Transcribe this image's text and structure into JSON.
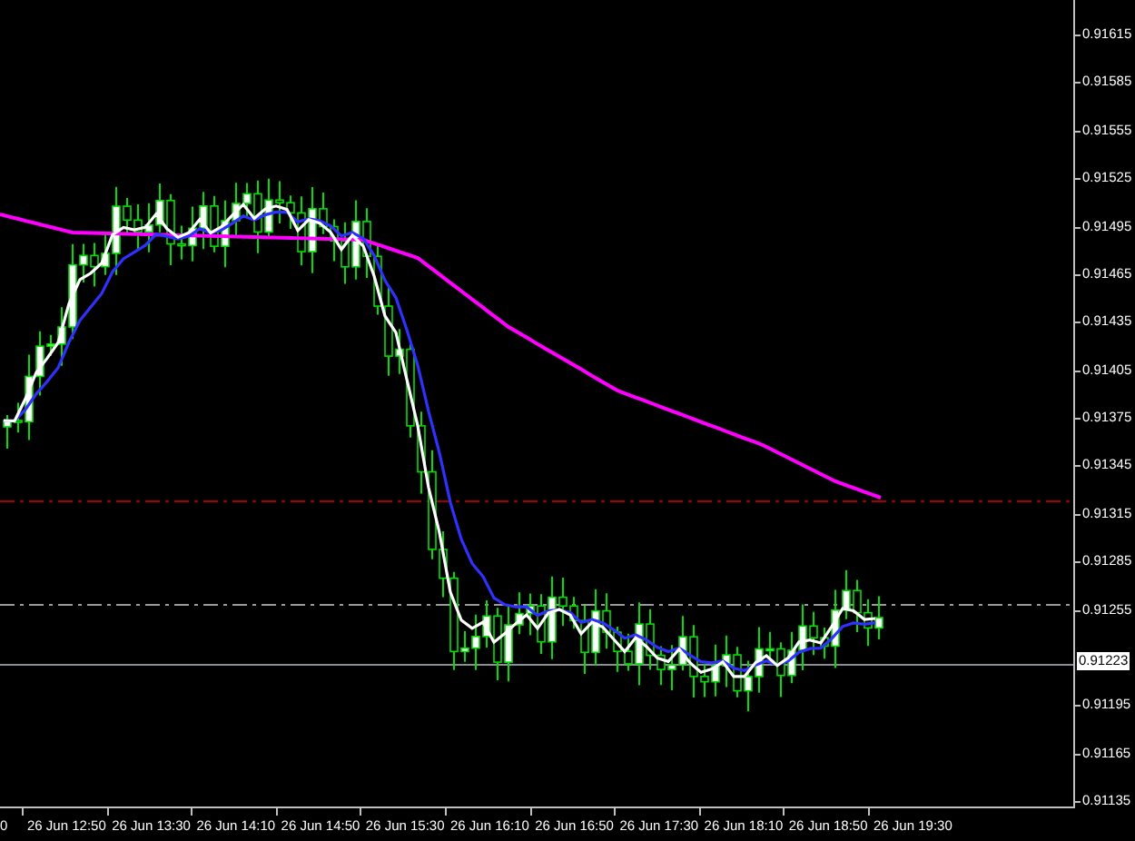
{
  "price_axis": {
    "labels": [
      {
        "text": "0.91615",
        "kind": "tick"
      },
      {
        "text": "0.91585",
        "kind": "tick"
      },
      {
        "text": "0.91555",
        "kind": "tick"
      },
      {
        "text": "0.91525",
        "kind": "tick"
      },
      {
        "text": "0.91495",
        "kind": "tick"
      },
      {
        "text": "0.91465",
        "kind": "tick"
      },
      {
        "text": "0.91435",
        "kind": "tick"
      },
      {
        "text": "0.91405",
        "kind": "tick"
      },
      {
        "text": "0.91375",
        "kind": "tick"
      },
      {
        "text": "0.91345",
        "kind": "tick"
      },
      {
        "text": "0.91315",
        "kind": "tick"
      },
      {
        "text": "0.91285",
        "kind": "tick"
      },
      {
        "text": "0.91255",
        "kind": "tick"
      },
      {
        "text": "0.91223",
        "kind": "current"
      },
      {
        "text": "0.91195",
        "kind": "tick"
      },
      {
        "text": "0.91165",
        "kind": "tick"
      },
      {
        "text": "0.91135",
        "kind": "tick"
      }
    ]
  },
  "time_axis": {
    "labels": [
      "0",
      "26 Jun 12:50",
      "26 Jun 13:30",
      "26 Jun 14:10",
      "26 Jun 14:50",
      "26 Jun 15:30",
      "26 Jun 16:10",
      "26 Jun 16:50",
      "26 Jun 17:30",
      "26 Jun 18:10",
      "26 Jun 18:50",
      "26 Jun 19:30"
    ]
  }
}
